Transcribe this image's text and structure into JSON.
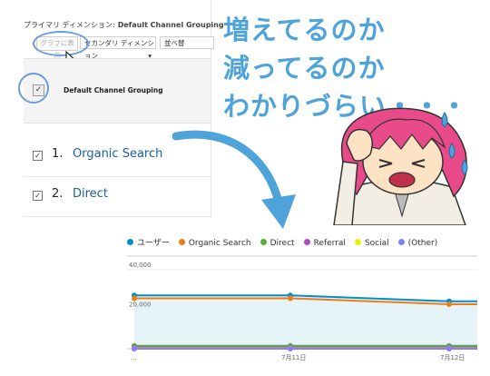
{
  "table": {
    "primary_dimension_label": "プライマリ ディメンション:",
    "primary_dimension_value": "Default Channel Grouping",
    "plot_button": "グラフに表示",
    "secondary_dimension": "セカンダリ ディメンション",
    "sort_label": "並べ替",
    "column_header": "Default Channel Grouping",
    "rows": [
      {
        "num": "1.",
        "label": "Organic Search"
      },
      {
        "num": "2.",
        "label": "Direct"
      }
    ]
  },
  "caption": {
    "line1": "増えてるのか",
    "line2": "減ってるのか",
    "line3": "わかりづらい・・・"
  },
  "colors": {
    "accent": "#4da3da",
    "link": "#1a5e9e",
    "highlight": "#6a9cde"
  },
  "chart_data": {
    "type": "line",
    "legend": [
      "ユーザー",
      "Organic Search",
      "Direct",
      "Referral",
      "Social",
      "(Other)"
    ],
    "series_colors": [
      "#058dc7",
      "#ed7e17",
      "#50b432",
      "#af49c5",
      "#edef00",
      "#8080ff"
    ],
    "x_labels": [
      "...",
      "7月11日",
      "7月12日"
    ],
    "y_labels": [
      "40,000",
      "20,000"
    ],
    "ylim": [
      0,
      45000
    ],
    "series": [
      {
        "name": "ユーザー",
        "values": [
          27000,
          27000,
          24000,
          24000
        ]
      },
      {
        "name": "Organic Search",
        "values": [
          25500,
          25500,
          22500,
          22500
        ]
      },
      {
        "name": "Direct",
        "values": [
          1500,
          1500,
          1500,
          1500
        ]
      },
      {
        "name": "Referral",
        "values": [
          700,
          700,
          700,
          700
        ]
      },
      {
        "name": "Social",
        "values": [
          200,
          200,
          200,
          200
        ]
      },
      {
        "name": "(Other)",
        "values": [
          0,
          0,
          0,
          0
        ]
      }
    ]
  }
}
